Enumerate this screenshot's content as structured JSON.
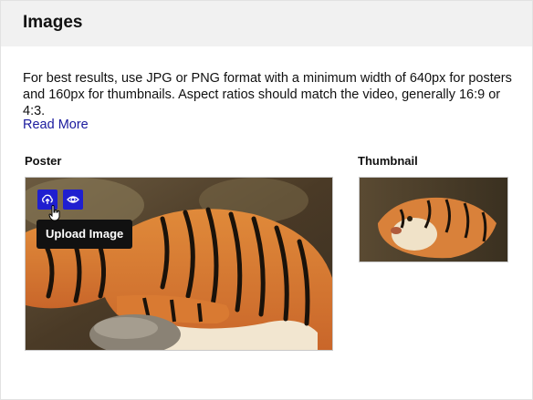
{
  "header": {
    "title": "Images"
  },
  "description": "For best results, use JPG or PNG format with a minimum width of 640px for posters and 160px for thumbnails. Aspect ratios should match the video, generally 16:9 or 4:3.",
  "read_more_label": "Read More",
  "poster": {
    "label": "Poster",
    "image_alt": "tiger-image",
    "actions": [
      {
        "name": "upload",
        "icon": "upload-icon"
      },
      {
        "name": "view",
        "icon": "eye-icon"
      }
    ],
    "tooltip": "Upload Image"
  },
  "thumbnail": {
    "label": "Thumbnail",
    "image_alt": "tiger-image"
  },
  "colors": {
    "accent": "#1f1fd0",
    "link": "#1a1a9e",
    "header_bg": "#f1f1f1",
    "tooltip_bg": "#111111"
  }
}
